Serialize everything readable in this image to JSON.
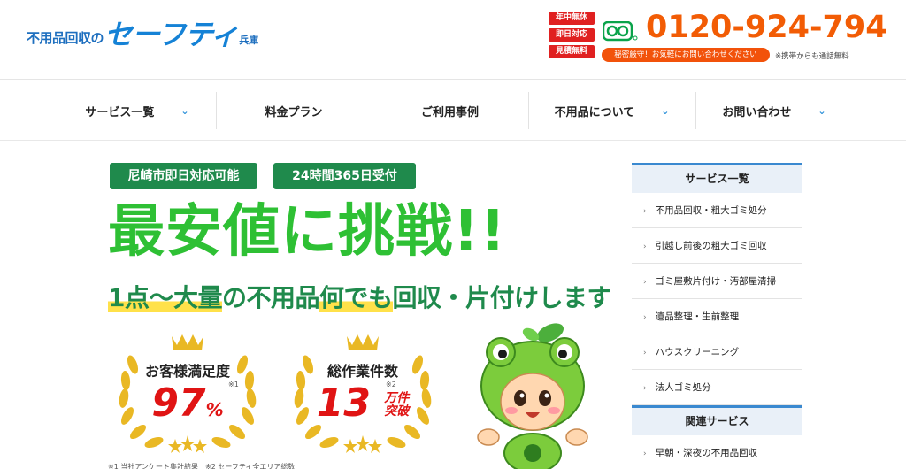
{
  "header": {
    "logo_prefix": "不用品回収の",
    "logo_brand": "セーフティ",
    "logo_suffix": "兵庫",
    "badges": [
      "年中無休",
      "即日対応",
      "見積無料"
    ],
    "phone": "0120-924-794",
    "phone_pill": "秘密厳守！お気軽にお問い合わせください",
    "phone_note": "※携帯からも通話無料",
    "colors": {
      "brand_blue": "#1582d6",
      "phone_orange": "#f25c05",
      "badge_red": "#e02020",
      "freedial_green": "#0aa34a"
    }
  },
  "nav": {
    "items": [
      {
        "label": "サービス一覧",
        "has_dropdown": true
      },
      {
        "label": "料金プラン",
        "has_dropdown": false
      },
      {
        "label": "ご利用事例",
        "has_dropdown": false
      },
      {
        "label": "不用品について",
        "has_dropdown": true
      },
      {
        "label": "お問い合わせ",
        "has_dropdown": true
      }
    ],
    "dropdown_icon": "chevron-down-icon"
  },
  "hero": {
    "tags": [
      "尼崎市即日対応可能",
      "24時間365日受付"
    ],
    "headline": "最安値に挑戦!!",
    "sub_hl1": "1点〜大量",
    "sub_mid": "の不用品",
    "sub_hl2": "何でも",
    "sub_end": "回収・片付けします",
    "awards": [
      {
        "title": "お客様満足度",
        "value": "97",
        "unit": "%",
        "note": "※1"
      },
      {
        "title": "総作業件数",
        "value": "13",
        "unit_line1": "万件",
        "unit_line2": "突破",
        "note": "※2"
      }
    ],
    "footnote": "※1 当社アンケート集計結果　※2 セーフティ全エリア総数",
    "colors": {
      "headline_green": "#2ec034",
      "tag_green": "#1f8a4c",
      "award_red": "#e01414",
      "highlight_yellow": "#ffe14a"
    }
  },
  "sidebar": {
    "title": "サービス一覧",
    "items": [
      "不用品回収・粗大ゴミ処分",
      "引越し前後の粗大ゴミ回収",
      "ゴミ屋敷片付け・汚部屋清掃",
      "遺品整理・生前整理",
      "ハウスクリーニング",
      "法人ゴミ処分"
    ],
    "title2": "関連サービス",
    "items2": [
      "早朝・深夜の不用品回収"
    ],
    "item_icon": "chevron-right-icon"
  }
}
